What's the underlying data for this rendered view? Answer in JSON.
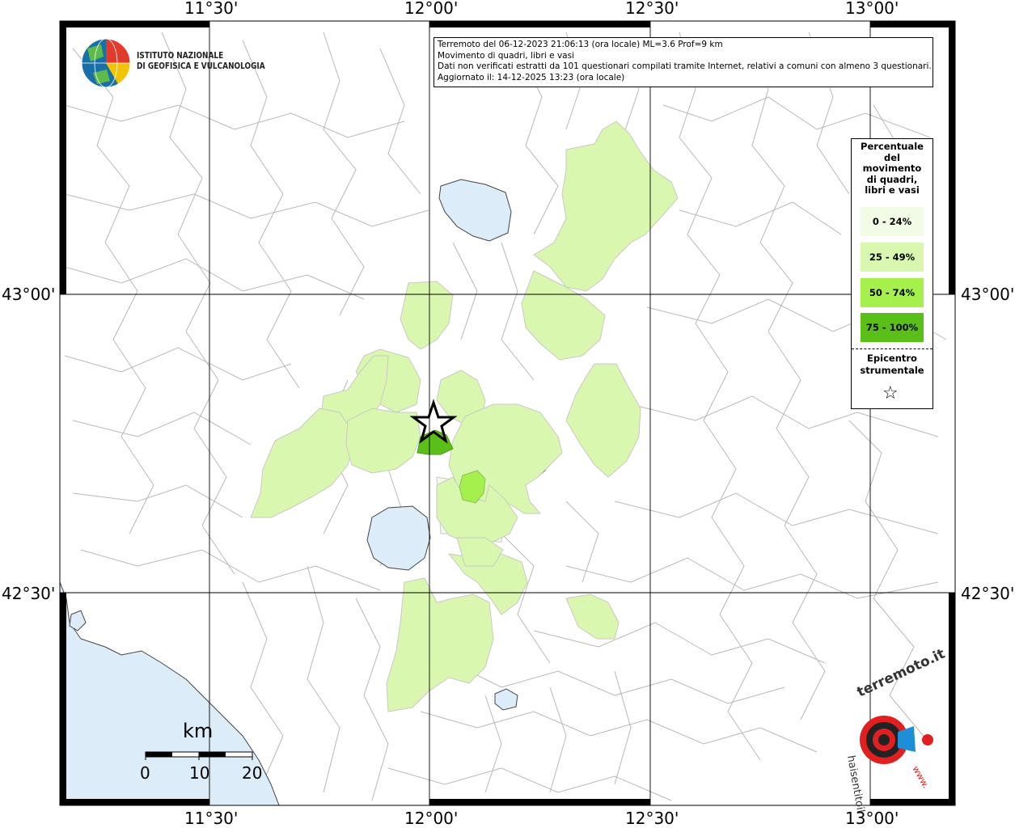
{
  "axes": {
    "top": [
      "11°30'",
      "12°00'",
      "12°30'",
      "13°00'"
    ],
    "bottom": [
      "11°30'",
      "12°00'",
      "12°30'",
      "13°00'"
    ],
    "left": [
      "43°00'",
      "42°30'"
    ],
    "right": [
      "43°00'",
      "42°30'"
    ]
  },
  "institute": {
    "line1": "ISTITUTO NAZIONALE",
    "line2": "DI GEOFISICA E VULCANOLOGIA"
  },
  "info": {
    "line1": "Terremoto del 06-12-2023 21:06:13 (ora locale) ML=3.6 Prof=9 km",
    "line2": "Movimento di quadri, libri e vasi",
    "line3": "Dati non verificati estratti da 101 questionari compilati tramite Internet, relativi a comuni con almeno 3 questionari.",
    "line4": "Aggiornato il: 14-12-2025 13:23 (ora locale)"
  },
  "legend": {
    "title_lines": [
      "Percentuale",
      "del",
      "movimento",
      "di quadri,",
      "libri e vasi"
    ],
    "classes": [
      {
        "label": "0 - 24%",
        "color": "#f2fbe6"
      },
      {
        "label": "25 - 49%",
        "color": "#d9f7ae"
      },
      {
        "label": "50 - 74%",
        "color": "#a6f04d"
      },
      {
        "label": "75 - 100%",
        "color": "#5bbf1a"
      }
    ],
    "epicenter_line1": "Epicentro",
    "epicenter_line2": "strumentale",
    "star_symbol": "☆"
  },
  "scale": {
    "unit": "km",
    "ticks": [
      "0",
      "10",
      "20"
    ]
  },
  "watermark": {
    "left_text": "hai sentito il",
    "main": "terremoto.it",
    "url": "www."
  },
  "colors": {
    "water": "#dcecf9",
    "boundary": "#b4b4b4",
    "grid": "#000000",
    "class0": "#f2fbe6",
    "class1": "#d9f7ae",
    "class2": "#a6f04d",
    "class3": "#5bbf1a"
  }
}
